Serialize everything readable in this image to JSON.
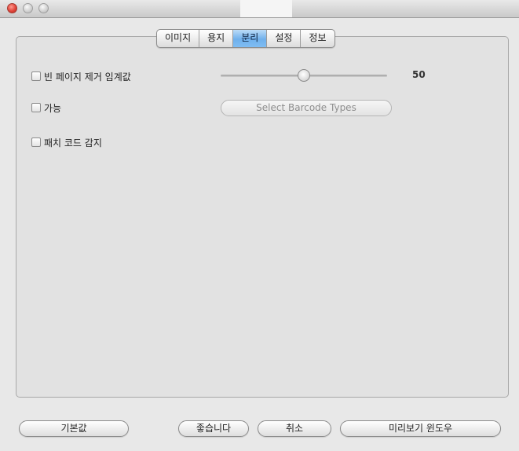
{
  "window": {
    "title": ""
  },
  "tabs": [
    {
      "label": "이미지",
      "active": false
    },
    {
      "label": "용지",
      "active": false
    },
    {
      "label": "분리",
      "active": true
    },
    {
      "label": "설정",
      "active": false
    },
    {
      "label": "정보",
      "active": false
    }
  ],
  "options": {
    "blank_page": {
      "label": "빈 페이지 제거 임계값",
      "checked": false
    },
    "barcode": {
      "label": "가능",
      "checked": false
    },
    "patch_code": {
      "label": "패치 코드 감지",
      "checked": false
    }
  },
  "threshold_slider": {
    "value": 50,
    "min": 0,
    "max": 100,
    "value_text": "50"
  },
  "barcode_types_button": {
    "label": "Select Barcode Types",
    "enabled": false
  },
  "footer": {
    "default_label": "기본값",
    "ok_label": "좋습니다",
    "cancel_label": "취소",
    "preview_label": "미리보기 윈도우"
  },
  "colors": {
    "accent": "#6fb0ec",
    "close": "#e0443a"
  }
}
